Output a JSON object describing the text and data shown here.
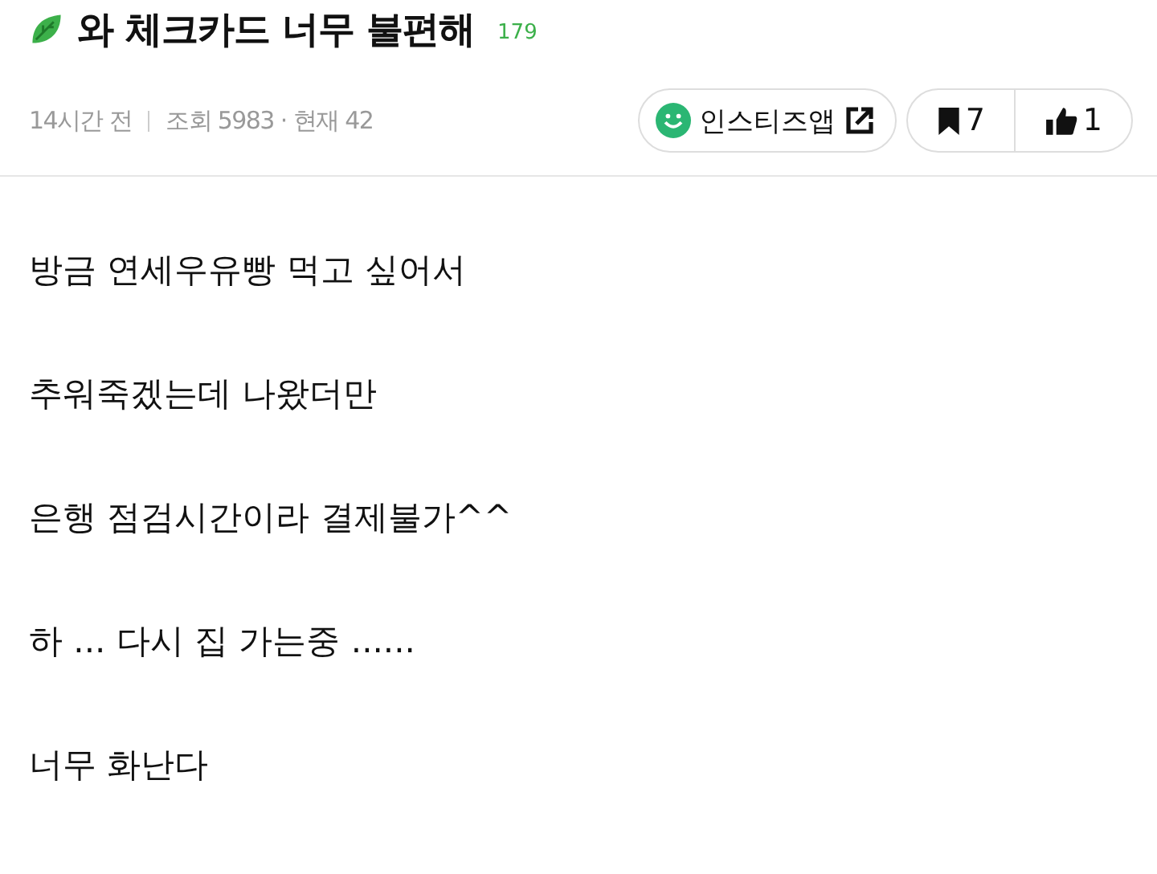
{
  "post": {
    "title": "와 체크카드 너무 불편해",
    "comment_count": "179",
    "time": "14시간 전",
    "views": "조회 5983 · 현재 42"
  },
  "actions": {
    "app_link": "인스티즈앱",
    "bookmarks": "7",
    "likes": "1"
  },
  "body": [
    "방금 연세우유빵 먹고 싶어서",
    "추워죽겠는데 나왔더만",
    "은행 점검시간이라 결제불가^^",
    "하 ... 다시 집 가는중 ......",
    "너무 화난다"
  ]
}
